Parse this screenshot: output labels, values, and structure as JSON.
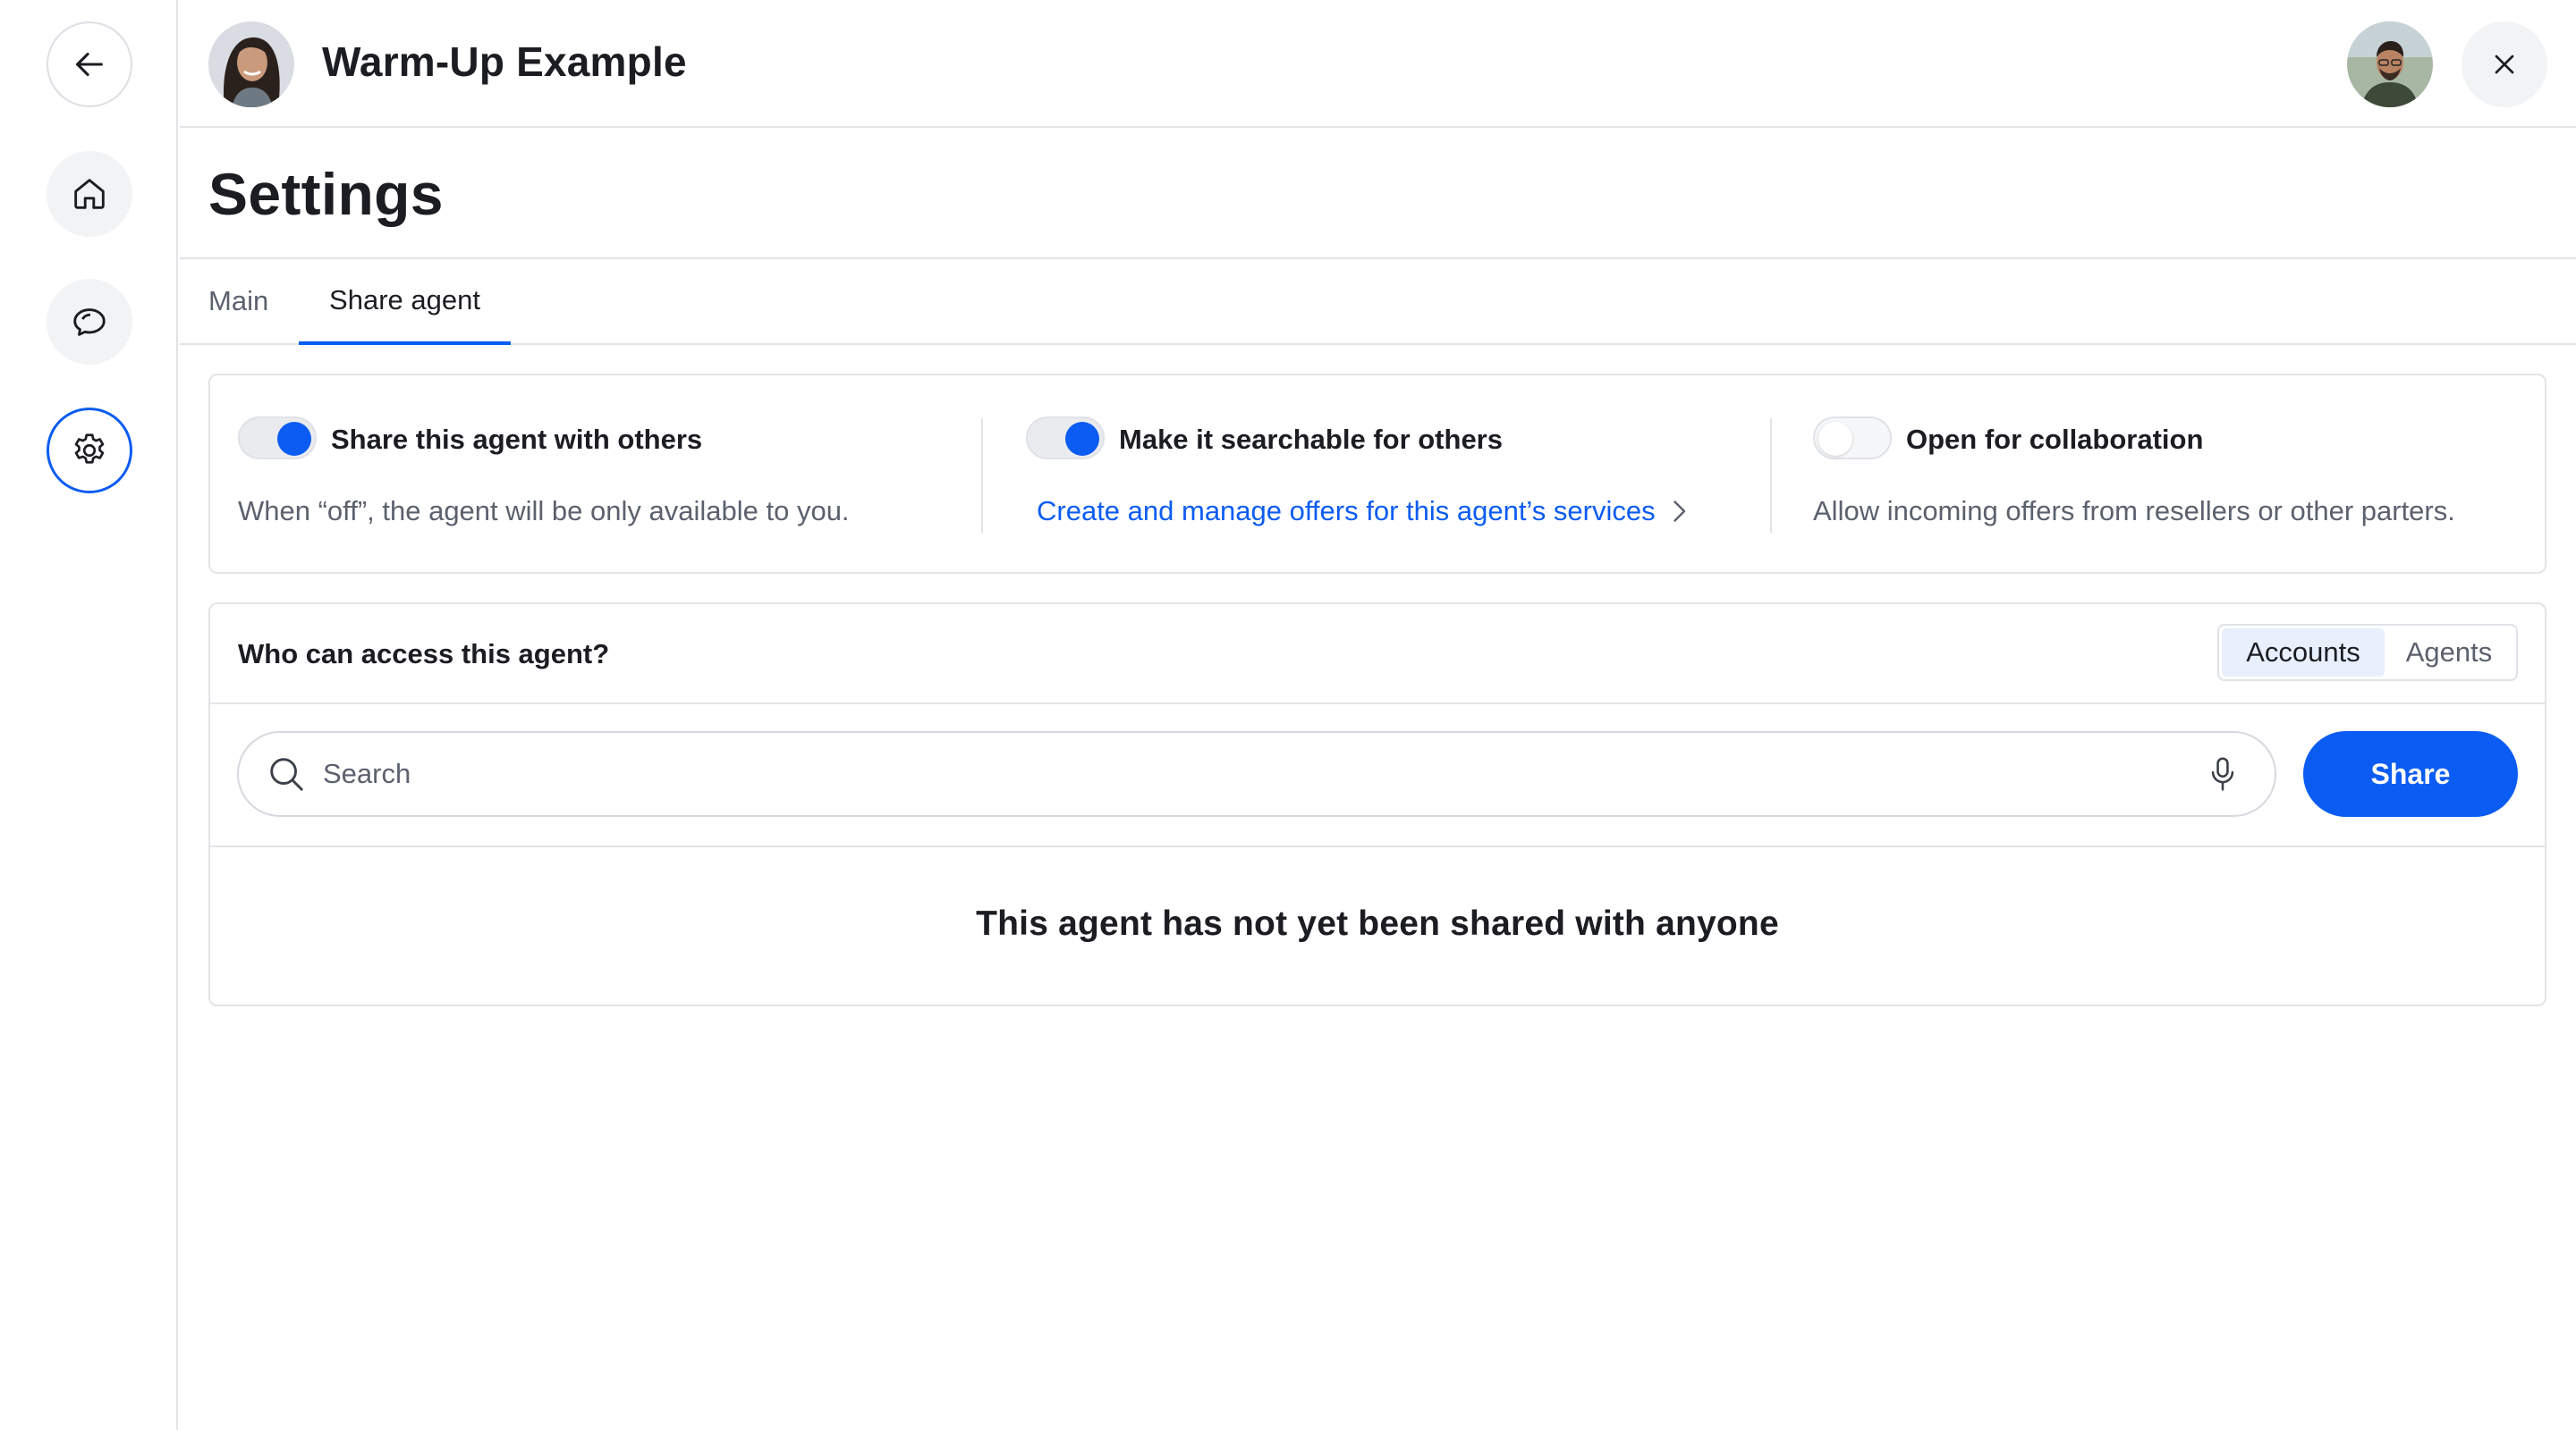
{
  "header": {
    "agent_name": "Warm-Up Example"
  },
  "page": {
    "title": "Settings"
  },
  "tabs": [
    {
      "label": "Main",
      "active": false
    },
    {
      "label": "Share agent",
      "active": true
    }
  ],
  "sharing_options": [
    {
      "label": "Share this agent with others",
      "enabled": true,
      "description": "When “off”, the agent will be only available to you."
    },
    {
      "label": "Make it searchable for others",
      "enabled": true,
      "link": "Create and manage offers for this agent’s services"
    },
    {
      "label": "Open for collaboration",
      "enabled": false,
      "description": "Allow incoming offers from resellers or other parters."
    }
  ],
  "access": {
    "title": "Who can access this agent?",
    "segments": [
      {
        "label": "Accounts",
        "active": true
      },
      {
        "label": "Agents",
        "active": false
      }
    ],
    "search_placeholder": "Search",
    "share_label": "Share",
    "empty_message": "This agent has not yet been shared with anyone"
  },
  "colors": {
    "accent": "#0b5cf2",
    "border": "#e2e4e8",
    "text": "#1b1d22",
    "muted": "#5b616d"
  },
  "icons": {
    "rail": [
      "arrow-left-icon",
      "home-icon",
      "chat-bubbles-icon",
      "gear-icon"
    ],
    "header": [
      "close-icon"
    ],
    "search": [
      "search-icon",
      "microphone-icon"
    ],
    "link": "chevron-right-icon"
  }
}
